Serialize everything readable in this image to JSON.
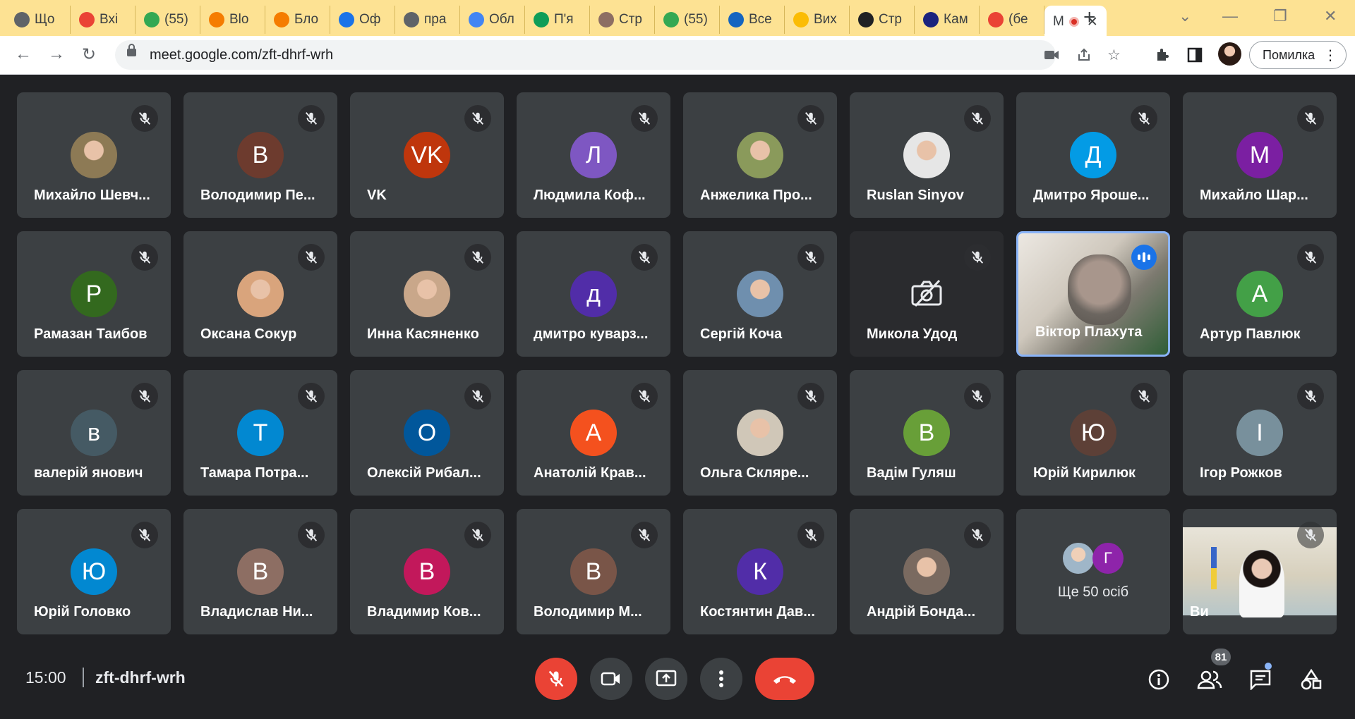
{
  "browser": {
    "tabs": [
      {
        "label": "Що",
        "icon": "chrome-icon",
        "color": "#5f6368"
      },
      {
        "label": "Вхі",
        "icon": "gmail-icon",
        "color": "#ea4335"
      },
      {
        "label": "(55)",
        "icon": "mail-icon",
        "color": "#34a853"
      },
      {
        "label": "Blo",
        "icon": "blogger-icon",
        "color": "#f57c00"
      },
      {
        "label": "Бло",
        "icon": "blogger-icon",
        "color": "#f57c00"
      },
      {
        "label": "Оф",
        "icon": "office-icon",
        "color": "#1a73e8"
      },
      {
        "label": "пра",
        "icon": "web-icon",
        "color": "#5f6368"
      },
      {
        "label": "Обл",
        "icon": "google-icon",
        "color": "#4285f4"
      },
      {
        "label": "П'я",
        "icon": "circle-icon",
        "color": "#0f9d58"
      },
      {
        "label": "Стр",
        "icon": "coat-icon",
        "color": "#8d6e63"
      },
      {
        "label": "(55)",
        "icon": "mail-icon",
        "color": "#34a853"
      },
      {
        "label": "Все",
        "icon": "drive-icon",
        "color": "#1565c0"
      },
      {
        "label": "Вих",
        "icon": "bell-icon",
        "color": "#fbbc04"
      },
      {
        "label": "Стр",
        "icon": "j-icon",
        "color": "#202124"
      },
      {
        "label": "Кам",
        "icon": "n1-icon",
        "color": "#1a237e"
      },
      {
        "label": "(бе",
        "icon": "gmail-icon",
        "color": "#ea4335"
      }
    ],
    "active_tab": {
      "label": "M"
    },
    "address": "meet.google.com/zft-dhrf-wrh",
    "error_button": "Помилка"
  },
  "meeting": {
    "participants": [
      {
        "name": "Михайло Шевч...",
        "initial": "",
        "color": "#8d7a55",
        "photo": true
      },
      {
        "name": "Володимир Пе...",
        "initial": "В",
        "color": "#6d3b2e"
      },
      {
        "name": "VK",
        "initial": "VK",
        "color": "#bf360c"
      },
      {
        "name": "Людмила Коф...",
        "initial": "Л",
        "color": "#7e57c2"
      },
      {
        "name": "Анжелика Про...",
        "initial": "",
        "color": "#8a9a5b",
        "photo": true
      },
      {
        "name": "Ruslan Sinyov",
        "initial": "",
        "color": "#e6e6e6",
        "photo": true
      },
      {
        "name": "Дмитро Яроше...",
        "initial": "Д",
        "color": "#039be5"
      },
      {
        "name": "Михайло Шар...",
        "initial": "М",
        "color": "#7b1fa2"
      },
      {
        "name": "Рамазан Таибов",
        "initial": "Р",
        "color": "#33691e"
      },
      {
        "name": "Оксана Сокур",
        "initial": "",
        "color": "#d9a47c",
        "photo": true
      },
      {
        "name": "Инна Касяненко",
        "initial": "",
        "color": "#c9a78a",
        "photo": true
      },
      {
        "name": "дмитро куварз...",
        "initial": "д",
        "color": "#512da8"
      },
      {
        "name": "Сергій Коча",
        "initial": "",
        "color": "#6f8fae",
        "photo": true
      },
      {
        "name": "Микола Удод",
        "initial": "",
        "color": "",
        "camoff": true
      },
      {
        "name": "Віктор Плахута",
        "initial": "",
        "color": "",
        "video": true,
        "speaking": true
      },
      {
        "name": "Артур Павлюк",
        "initial": "А",
        "color": "#43a047"
      },
      {
        "name": "валерій янович",
        "initial": "в",
        "color": "#455a64"
      },
      {
        "name": "Тамара Потра...",
        "initial": "Т",
        "color": "#0288d1"
      },
      {
        "name": "Олексій Рибал...",
        "initial": "О",
        "color": "#01579b"
      },
      {
        "name": "Анатолій Крав...",
        "initial": "А",
        "color": "#f4511e"
      },
      {
        "name": "Ольга Скляре...",
        "initial": "",
        "color": "#d0c7b8",
        "photo": true
      },
      {
        "name": "Вадім Гуляш",
        "initial": "В",
        "color": "#689f38"
      },
      {
        "name": "Юрій Кирилюк",
        "initial": "Ю",
        "color": "#5d4037"
      },
      {
        "name": "Ігор Рожков",
        "initial": "І",
        "color": "#78909c"
      },
      {
        "name": "Юрій Головко",
        "initial": "Ю",
        "color": "#0288d1"
      },
      {
        "name": "Владислав Ни...",
        "initial": "В",
        "color": "#8d6e63"
      },
      {
        "name": "Владимир Ков...",
        "initial": "В",
        "color": "#c2185b"
      },
      {
        "name": "Володимир М...",
        "initial": "В",
        "color": "#795548"
      },
      {
        "name": "Костянтин Дав...",
        "initial": "К",
        "color": "#512da8"
      },
      {
        "name": "Андрій Бонда...",
        "initial": "",
        "color": "#7a6a60",
        "photo": true
      }
    ],
    "more_tile": {
      "label": "Ще 50 осіб",
      "second_initial": "Г",
      "second_color": "#8e24aa"
    },
    "last_tile": {
      "name": "Ви"
    }
  },
  "bottom": {
    "time": "15:00",
    "code": "zft-dhrf-wrh",
    "participant_count": "81"
  }
}
